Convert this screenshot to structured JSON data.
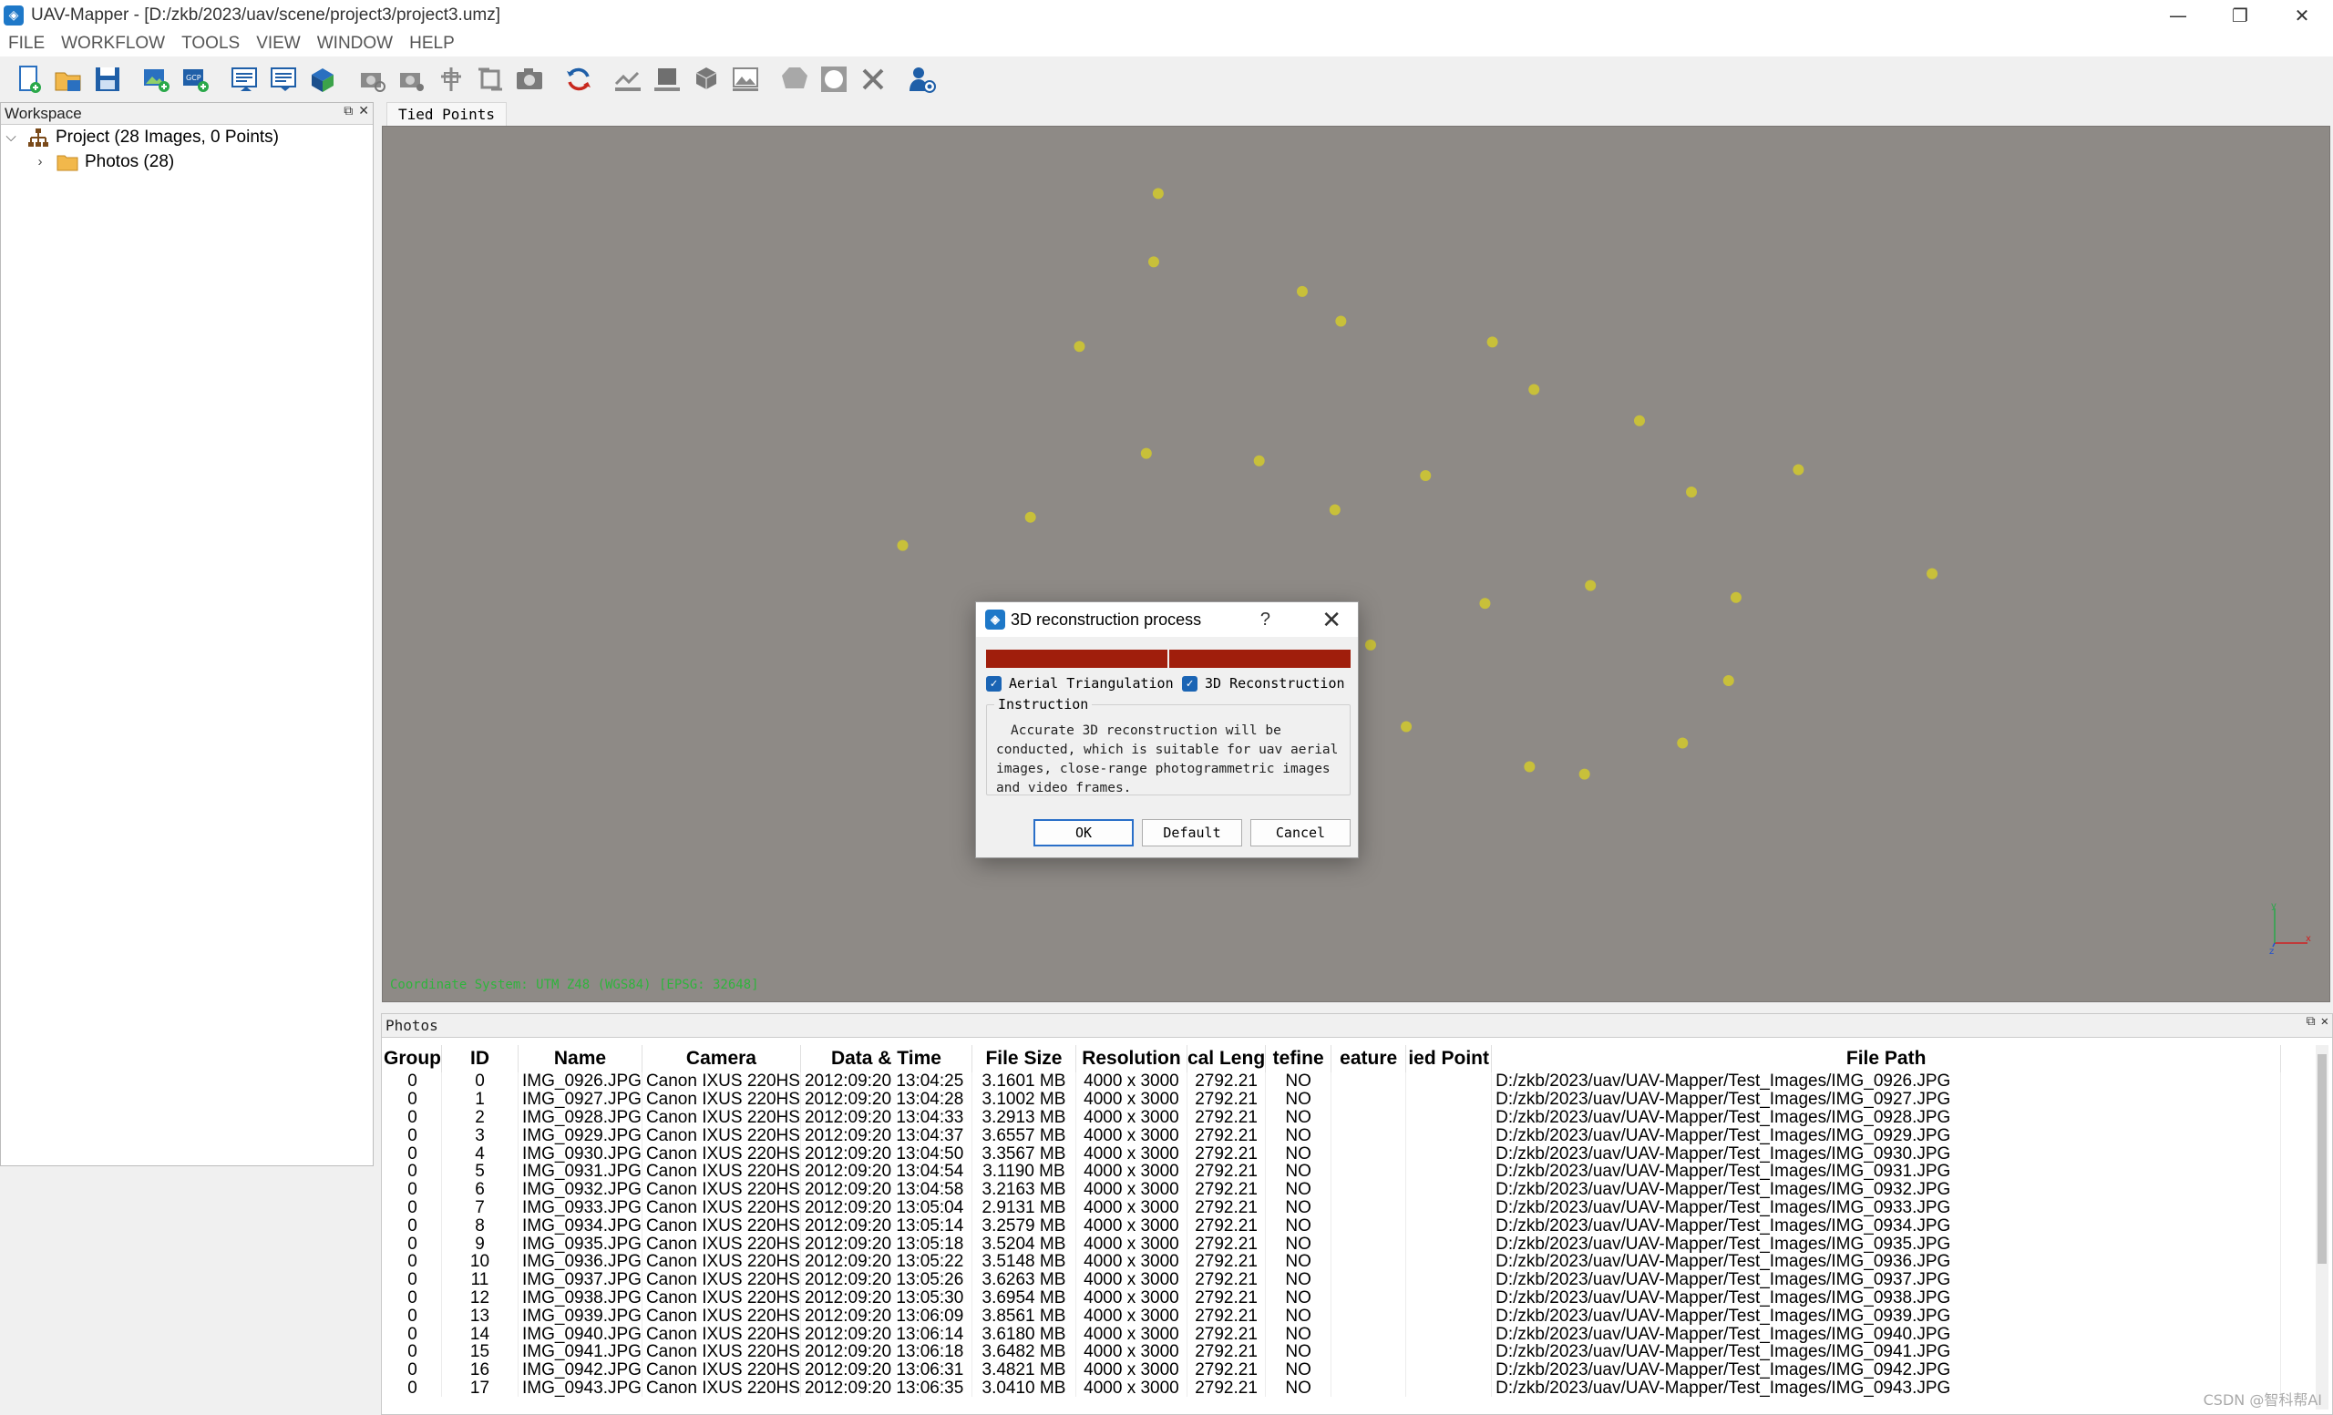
{
  "window": {
    "title": "UAV-Mapper - [D:/zkb/2023/uav/scene/project3/project3.umz]",
    "minimize": "—",
    "restore": "❐",
    "close": "✕"
  },
  "menu": [
    "FILE",
    "WORKFLOW",
    "TOOLS",
    "VIEW",
    "WINDOW",
    "HELP"
  ],
  "workspace": {
    "title": "Workspace",
    "project_label": "Project (28 Images, 0 Points)",
    "photos_label": "Photos (28)"
  },
  "viewport": {
    "tab": "Tied Points",
    "coord_text": "Coordinate System: UTM Z48 (WGS84) [EPSG: 32648]",
    "background": "#8e8a86",
    "point_color": "#c8c03a"
  },
  "dialog": {
    "title": "3D reconstruction process",
    "help": "?",
    "close": "✕",
    "check_aerial": "Aerial Triangulation",
    "check_recon": "3D Reconstruction",
    "instruction_label": "Instruction",
    "instruction_text": "Accurate 3D reconstruction will be conducted, which is suitable for uav aerial images, close-range photogrammetric images and video frames.",
    "ok": "OK",
    "default": "Default",
    "cancel": "Cancel"
  },
  "photos": {
    "title": "Photos",
    "columns": [
      "Group",
      "ID",
      "Name",
      "Camera",
      "Data & Time",
      "File Size",
      "Resolution",
      "cal Leng",
      "tefine",
      "eature",
      "ied Point",
      "File Path"
    ],
    "rows": [
      [
        "0",
        "0",
        "IMG_0926.JPG",
        "Canon IXUS 220HS",
        "2012:09:20 13:04:25",
        "3.1601 MB",
        "4000 x 3000",
        "2792.21",
        "NO",
        "",
        "",
        "D:/zkb/2023/uav/UAV-Mapper/Test_Images/IMG_0926.JPG"
      ],
      [
        "0",
        "1",
        "IMG_0927.JPG",
        "Canon IXUS 220HS",
        "2012:09:20 13:04:28",
        "3.1002 MB",
        "4000 x 3000",
        "2792.21",
        "NO",
        "",
        "",
        "D:/zkb/2023/uav/UAV-Mapper/Test_Images/IMG_0927.JPG"
      ],
      [
        "0",
        "2",
        "IMG_0928.JPG",
        "Canon IXUS 220HS",
        "2012:09:20 13:04:33",
        "3.2913 MB",
        "4000 x 3000",
        "2792.21",
        "NO",
        "",
        "",
        "D:/zkb/2023/uav/UAV-Mapper/Test_Images/IMG_0928.JPG"
      ],
      [
        "0",
        "3",
        "IMG_0929.JPG",
        "Canon IXUS 220HS",
        "2012:09:20 13:04:37",
        "3.6557 MB",
        "4000 x 3000",
        "2792.21",
        "NO",
        "",
        "",
        "D:/zkb/2023/uav/UAV-Mapper/Test_Images/IMG_0929.JPG"
      ],
      [
        "0",
        "4",
        "IMG_0930.JPG",
        "Canon IXUS 220HS",
        "2012:09:20 13:04:50",
        "3.3567 MB",
        "4000 x 3000",
        "2792.21",
        "NO",
        "",
        "",
        "D:/zkb/2023/uav/UAV-Mapper/Test_Images/IMG_0930.JPG"
      ],
      [
        "0",
        "5",
        "IMG_0931.JPG",
        "Canon IXUS 220HS",
        "2012:09:20 13:04:54",
        "3.1190 MB",
        "4000 x 3000",
        "2792.21",
        "NO",
        "",
        "",
        "D:/zkb/2023/uav/UAV-Mapper/Test_Images/IMG_0931.JPG"
      ],
      [
        "0",
        "6",
        "IMG_0932.JPG",
        "Canon IXUS 220HS",
        "2012:09:20 13:04:58",
        "3.2163 MB",
        "4000 x 3000",
        "2792.21",
        "NO",
        "",
        "",
        "D:/zkb/2023/uav/UAV-Mapper/Test_Images/IMG_0932.JPG"
      ],
      [
        "0",
        "7",
        "IMG_0933.JPG",
        "Canon IXUS 220HS",
        "2012:09:20 13:05:04",
        "2.9131 MB",
        "4000 x 3000",
        "2792.21",
        "NO",
        "",
        "",
        "D:/zkb/2023/uav/UAV-Mapper/Test_Images/IMG_0933.JPG"
      ],
      [
        "0",
        "8",
        "IMG_0934.JPG",
        "Canon IXUS 220HS",
        "2012:09:20 13:05:14",
        "3.2579 MB",
        "4000 x 3000",
        "2792.21",
        "NO",
        "",
        "",
        "D:/zkb/2023/uav/UAV-Mapper/Test_Images/IMG_0934.JPG"
      ],
      [
        "0",
        "9",
        "IMG_0935.JPG",
        "Canon IXUS 220HS",
        "2012:09:20 13:05:18",
        "3.5204 MB",
        "4000 x 3000",
        "2792.21",
        "NO",
        "",
        "",
        "D:/zkb/2023/uav/UAV-Mapper/Test_Images/IMG_0935.JPG"
      ],
      [
        "0",
        "10",
        "IMG_0936.JPG",
        "Canon IXUS 220HS",
        "2012:09:20 13:05:22",
        "3.5148 MB",
        "4000 x 3000",
        "2792.21",
        "NO",
        "",
        "",
        "D:/zkb/2023/uav/UAV-Mapper/Test_Images/IMG_0936.JPG"
      ],
      [
        "0",
        "11",
        "IMG_0937.JPG",
        "Canon IXUS 220HS",
        "2012:09:20 13:05:26",
        "3.6263 MB",
        "4000 x 3000",
        "2792.21",
        "NO",
        "",
        "",
        "D:/zkb/2023/uav/UAV-Mapper/Test_Images/IMG_0937.JPG"
      ],
      [
        "0",
        "12",
        "IMG_0938.JPG",
        "Canon IXUS 220HS",
        "2012:09:20 13:05:30",
        "3.6954 MB",
        "4000 x 3000",
        "2792.21",
        "NO",
        "",
        "",
        "D:/zkb/2023/uav/UAV-Mapper/Test_Images/IMG_0938.JPG"
      ],
      [
        "0",
        "13",
        "IMG_0939.JPG",
        "Canon IXUS 220HS",
        "2012:09:20 13:06:09",
        "3.8561 MB",
        "4000 x 3000",
        "2792.21",
        "NO",
        "",
        "",
        "D:/zkb/2023/uav/UAV-Mapper/Test_Images/IMG_0939.JPG"
      ],
      [
        "0",
        "14",
        "IMG_0940.JPG",
        "Canon IXUS 220HS",
        "2012:09:20 13:06:14",
        "3.6180 MB",
        "4000 x 3000",
        "2792.21",
        "NO",
        "",
        "",
        "D:/zkb/2023/uav/UAV-Mapper/Test_Images/IMG_0940.JPG"
      ],
      [
        "0",
        "15",
        "IMG_0941.JPG",
        "Canon IXUS 220HS",
        "2012:09:20 13:06:18",
        "3.6482 MB",
        "4000 x 3000",
        "2792.21",
        "NO",
        "",
        "",
        "D:/zkb/2023/uav/UAV-Mapper/Test_Images/IMG_0941.JPG"
      ],
      [
        "0",
        "16",
        "IMG_0942.JPG",
        "Canon IXUS 220HS",
        "2012:09:20 13:06:31",
        "3.4821 MB",
        "4000 x 3000",
        "2792.21",
        "NO",
        "",
        "",
        "D:/zkb/2023/uav/UAV-Mapper/Test_Images/IMG_0942.JPG"
      ],
      [
        "0",
        "17",
        "IMG_0943.JPG",
        "Canon IXUS 220HS",
        "2012:09:20 13:06:35",
        "3.0410 MB",
        "4000 x 3000",
        "2792.21",
        "NO",
        "",
        "",
        "D:/zkb/2023/uav/UAV-Mapper/Test_Images/IMG_0943.JPG"
      ]
    ]
  },
  "watermark": "CSDN @智科帮AI"
}
